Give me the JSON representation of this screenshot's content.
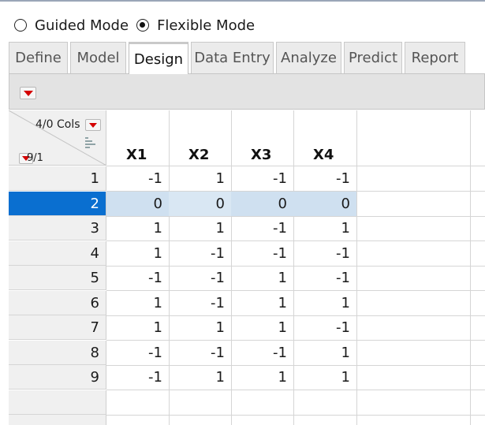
{
  "mode": {
    "options": [
      {
        "label": "Guided Mode",
        "checked": false
      },
      {
        "label": "Flexible Mode",
        "checked": true
      }
    ]
  },
  "tabs": [
    {
      "label": "Define",
      "active": false
    },
    {
      "label": "Model",
      "active": false
    },
    {
      "label": "Design",
      "active": true
    },
    {
      "label": "Data Entry",
      "active": false
    },
    {
      "label": "Analyze",
      "active": false
    },
    {
      "label": "Predict",
      "active": false
    },
    {
      "label": "Report",
      "active": false
    }
  ],
  "table": {
    "cols_label": "4/0 Cols",
    "rows_label": "9/1",
    "columns": [
      "X1",
      "X2",
      "X3",
      "X4"
    ],
    "selected_row": 2,
    "rows": [
      {
        "n": "1",
        "values": [
          "-1",
          "1",
          "-1",
          "-1"
        ]
      },
      {
        "n": "2",
        "values": [
          "0",
          "0",
          "0",
          "0"
        ]
      },
      {
        "n": "3",
        "values": [
          "1",
          "1",
          "-1",
          "1"
        ]
      },
      {
        "n": "4",
        "values": [
          "1",
          "-1",
          "-1",
          "-1"
        ]
      },
      {
        "n": "5",
        "values": [
          "-1",
          "-1",
          "1",
          "-1"
        ]
      },
      {
        "n": "6",
        "values": [
          "1",
          "-1",
          "1",
          "1"
        ]
      },
      {
        "n": "7",
        "values": [
          "1",
          "1",
          "1",
          "-1"
        ]
      },
      {
        "n": "8",
        "values": [
          "-1",
          "-1",
          "-1",
          "1"
        ]
      },
      {
        "n": "9",
        "values": [
          "-1",
          "1",
          "1",
          "1"
        ]
      }
    ]
  },
  "colors": {
    "selected_row_header": "#0a6fd0",
    "selected_row_cells": "#cfe0f0",
    "menu_triangle": "#d40000"
  }
}
